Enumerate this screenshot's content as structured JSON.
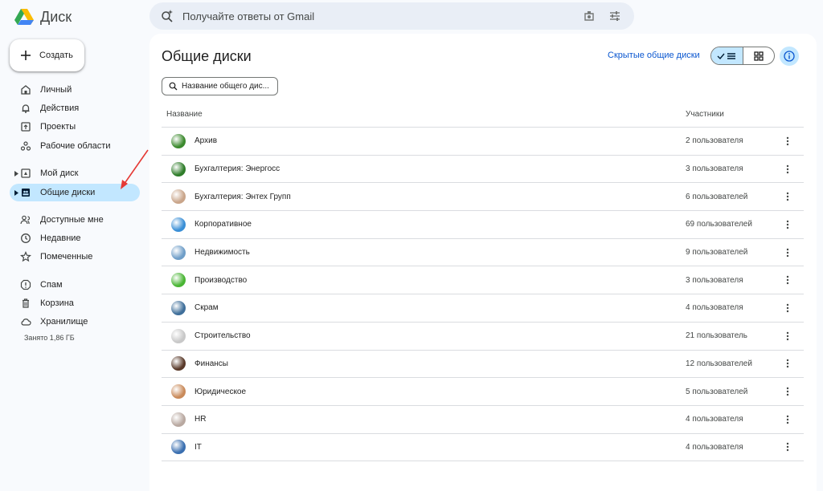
{
  "app": {
    "title": "Диск"
  },
  "search": {
    "placeholder": "Получайте ответы от Gmail"
  },
  "sidebar": {
    "create_label": "Создать",
    "items": [
      {
        "label": "Личный",
        "icon": "home-icon"
      },
      {
        "label": "Действия",
        "icon": "bell-icon"
      },
      {
        "label": "Проекты",
        "icon": "project-icon"
      },
      {
        "label": "Рабочие области",
        "icon": "workspaces-icon"
      },
      {
        "label": "Мой диск",
        "icon": "my-drive-icon"
      },
      {
        "label": "Общие диски",
        "icon": "shared-drives-icon",
        "active": true
      },
      {
        "label": "Доступные мне",
        "icon": "shared-with-me-icon"
      },
      {
        "label": "Недавние",
        "icon": "clock-icon"
      },
      {
        "label": "Помеченные",
        "icon": "star-icon"
      },
      {
        "label": "Спам",
        "icon": "spam-icon"
      },
      {
        "label": "Корзина",
        "icon": "trash-icon"
      },
      {
        "label": "Хранилище",
        "icon": "cloud-icon"
      }
    ],
    "storage_text": "Занято 1,86 ГБ"
  },
  "main": {
    "title": "Общие диски",
    "hidden_link": "Скрытые общие диски",
    "filter_placeholder": "Название общего дис...",
    "columns": {
      "name": "Название",
      "members": "Участники"
    },
    "rows": [
      {
        "name": "Архив",
        "members": "2 пользователя",
        "color": "#3c8a2e"
      },
      {
        "name": "Бухгалтерия: Энергосс",
        "members": "3 пользователя",
        "color": "#2f7d2a"
      },
      {
        "name": "Бухгалтерия: Энтех Групп",
        "members": "6 пользователей",
        "color": "#c9a58a"
      },
      {
        "name": "Корпоративное",
        "members": "69 пользователей",
        "color": "#3a8fd6"
      },
      {
        "name": "Недвижимость",
        "members": "9 пользователей",
        "color": "#6f9ec8"
      },
      {
        "name": "Производство",
        "members": "3 пользователя",
        "color": "#49b534"
      },
      {
        "name": "Скрам",
        "members": "4 пользователя",
        "color": "#3f6f9a"
      },
      {
        "name": "Строительство",
        "members": "21 пользователь",
        "color": "#c8c8c8"
      },
      {
        "name": "Финансы",
        "members": "12 пользователей",
        "color": "#5a3a2a"
      },
      {
        "name": "Юридическое",
        "members": "5 пользователей",
        "color": "#c98a5a"
      },
      {
        "name": "HR",
        "members": "4 пользователя",
        "color": "#b8a8a0"
      },
      {
        "name": "IT",
        "members": "4 пользователя",
        "color": "#3a6fb0"
      }
    ]
  },
  "colors": {
    "accent": "#0b57d0",
    "active_bg": "#c2e7ff",
    "arrow": "#e53935"
  }
}
